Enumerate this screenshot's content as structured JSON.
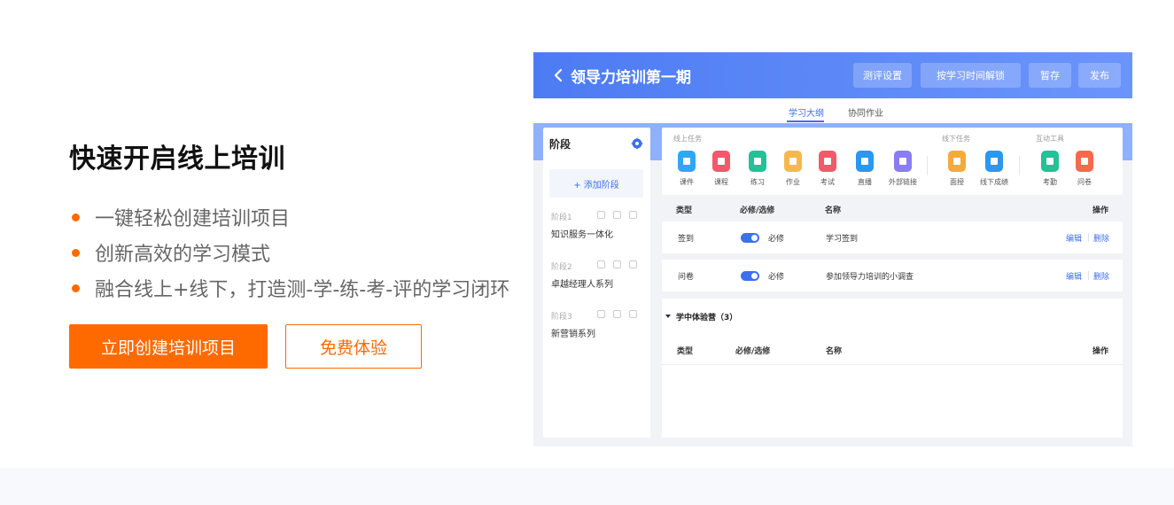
{
  "hero": {
    "title": "快速开启线上培训",
    "features": [
      "一键轻松创建培训项目",
      "创新高效的学习模式",
      "融合线上+线下，打造测-学-练-考-评的学习闭环"
    ],
    "primary_label": "立即创建培训项目",
    "secondary_label": "免费体验"
  },
  "colors": {
    "accent": "#ff6a00",
    "app_blue": "#4d7bf3",
    "link_blue": "#3d6ff0"
  },
  "app": {
    "title": "领导力培训第一期",
    "header_buttons": [
      "测评设置",
      "按学习时间解锁",
      "暂存",
      "发布"
    ],
    "tabs": [
      "学习大纲",
      "协同作业"
    ],
    "sidebar": {
      "title": "阶段",
      "add_label": "+ 添加阶段",
      "stages": [
        {
          "num": "阶段1",
          "name": "知识服务一体化"
        },
        {
          "num": "阶段2",
          "name": "卓越经理人系列"
        },
        {
          "num": "阶段3",
          "name": "新营销系列"
        }
      ]
    },
    "tools": {
      "online_label": "线上任务",
      "offline_label": "线下任务",
      "interactive_label": "互动工具",
      "online": [
        {
          "label": "课件",
          "icon": "courseware-icon",
          "color": "#2ea8f5"
        },
        {
          "label": "课程",
          "icon": "course-icon",
          "color": "#f5576c"
        },
        {
          "label": "练习",
          "icon": "practice-icon",
          "color": "#22c197"
        },
        {
          "label": "作业",
          "icon": "homework-icon",
          "color": "#f7b84b"
        },
        {
          "label": "考试",
          "icon": "exam-icon",
          "color": "#f15a6a"
        },
        {
          "label": "直播",
          "icon": "live-icon",
          "color": "#2a97f0"
        },
        {
          "label": "外部链接",
          "icon": "external-link-icon",
          "color": "#8a7cf4"
        }
      ],
      "offline": [
        {
          "label": "面授",
          "icon": "face-to-face-icon",
          "color": "#f7a93b"
        },
        {
          "label": "线下成绩",
          "icon": "offline-score-icon",
          "color": "#2a97f0"
        }
      ],
      "interactive": [
        {
          "label": "考勤",
          "icon": "attendance-icon",
          "color": "#22c197"
        },
        {
          "label": "问卷",
          "icon": "survey-icon",
          "color": "#f56a4a"
        }
      ]
    },
    "table": {
      "headers": {
        "type": "类型",
        "required": "必修/选修",
        "name": "名称",
        "ops": "操作"
      },
      "rows": [
        {
          "type": "签到",
          "required": "必修",
          "name": "学习签到",
          "edit": "编辑",
          "delete": "删除"
        },
        {
          "type": "问卷",
          "required": "必修",
          "name": "参加领导力培训的小调查",
          "edit": "编辑",
          "delete": "删除"
        }
      ]
    },
    "section": {
      "title": "学中体验营（3）",
      "headers": {
        "type": "类型",
        "required": "必修/选修",
        "name": "名称",
        "ops": "操作"
      }
    }
  }
}
